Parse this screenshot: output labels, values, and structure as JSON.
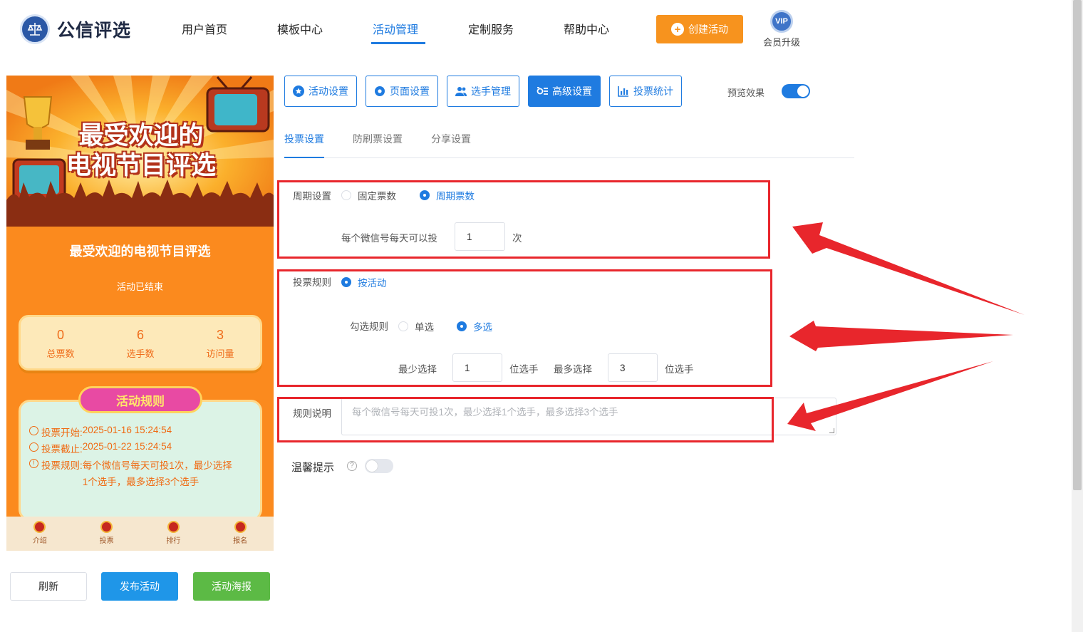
{
  "header": {
    "logo_text": "公信评选",
    "nav": [
      "用户首页",
      "模板中心",
      "活动管理",
      "定制服务",
      "帮助中心"
    ],
    "active_nav": "活动管理",
    "create_button": "创建活动",
    "vip_badge": "VIP",
    "vip_label": "会员升级"
  },
  "preview": {
    "banner_line1": "最受欢迎的",
    "banner_line2": "电视节目评选",
    "title": "最受欢迎的电视节目评选",
    "status": "活动已结束",
    "stats": [
      {
        "value": "0",
        "label": "总票数"
      },
      {
        "value": "6",
        "label": "选手数"
      },
      {
        "value": "3",
        "label": "访问量"
      }
    ],
    "rules_heading": "活动规则",
    "rules": {
      "start_label": "投票开始:",
      "start_value": "2025-01-16 15:24:54",
      "end_label": "投票截止:",
      "end_value": "2025-01-22 15:24:54",
      "rule_label": "投票规则:",
      "rule_value_1": "每个微信号每天可投1次，最少选择",
      "rule_value_2": "1个选手，最多选择3个选手"
    },
    "tabbar": [
      "介绍",
      "投票",
      "排行",
      "报名"
    ]
  },
  "actions": {
    "refresh": "刷新",
    "publish": "发布活动",
    "poster": "活动海报"
  },
  "settings": {
    "tabs": [
      "活动设置",
      "页面设置",
      "选手管理",
      "高级设置",
      "投票统计"
    ],
    "active_tab": "高级设置",
    "preview_label": "预览效果",
    "preview_on": true,
    "sub_tabs": [
      "投票设置",
      "防刷票设置",
      "分享设置"
    ],
    "active_sub_tab": "投票设置",
    "cycle": {
      "label": "周期设置",
      "options": [
        "固定票数",
        "周期票数"
      ],
      "selected": "周期票数",
      "per_day_label": "每个微信号每天可以投",
      "per_day_value": "1",
      "per_day_unit": "次"
    },
    "vote_rule": {
      "label": "投票规则",
      "option": "按活动",
      "check_label": "勾选规则",
      "check_options": [
        "单选",
        "多选"
      ],
      "check_selected": "多选",
      "min_label": "最少选择",
      "min_value": "1",
      "min_unit": "位选手",
      "max_label": "最多选择",
      "max_value": "3",
      "max_unit": "位选手"
    },
    "rule_desc": {
      "label": "规则说明",
      "placeholder": "每个微信号每天可投1次，最少选择1个选手，最多选择3个选手"
    },
    "warm_tip": {
      "label": "温馨提示",
      "help": "?",
      "enabled": false
    }
  },
  "annotation_color": "#e8262c",
  "accent_color": "#1f7be0"
}
